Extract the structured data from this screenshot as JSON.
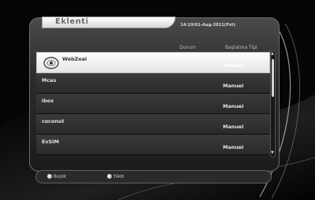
{
  "window": {
    "title": "Eklenti",
    "datetime": "14:19/01-Aug-2011(Pzt)"
  },
  "columns": {
    "status": "Durum",
    "start_type": "Başlatma Tipi"
  },
  "plugins": [
    {
      "name": "WebZeal",
      "start_type": "Manuel",
      "selected": true,
      "icon": "webzeal-logo-icon"
    },
    {
      "name": "Mcas",
      "start_type": "Manuel",
      "selected": false
    },
    {
      "name": "ibox",
      "start_type": "Manuel",
      "selected": false
    },
    {
      "name": "coconut",
      "start_type": "Manuel",
      "selected": false
    },
    {
      "name": "ExSIM",
      "start_type": "Manuel",
      "selected": false
    }
  ],
  "footer": {
    "start_label": "Başlat",
    "load_label": "Yükle"
  }
}
